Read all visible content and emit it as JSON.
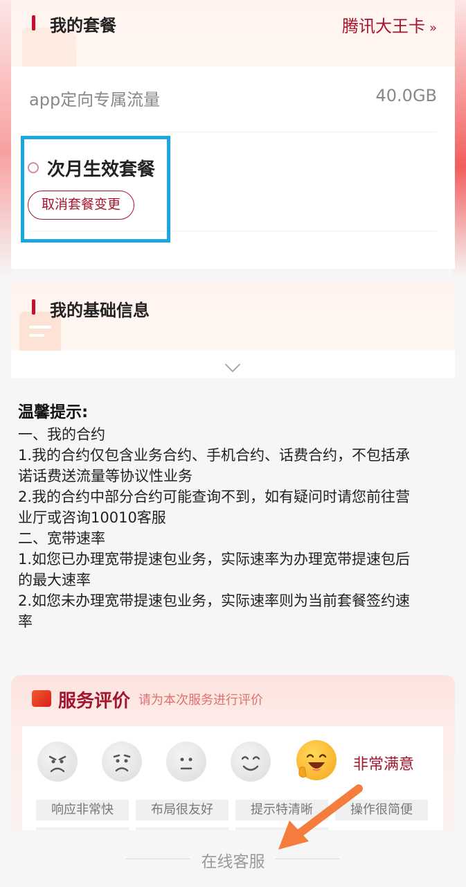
{
  "package": {
    "title": "我的套餐",
    "link_label": "腾讯大王卡",
    "link_arrows": "»",
    "rows": [
      {
        "label": "app定向专属流量",
        "value": "40.0GB"
      }
    ],
    "next_month": {
      "title": "次月生效套餐",
      "cancel_label": "取消套餐变更"
    }
  },
  "basic_info": {
    "title": "我的基础信息"
  },
  "tips": {
    "title": "温馨提示:",
    "lines": [
      "一、我的合约",
      "1.我的合约仅包含业务合约、手机合约、话费合约，不包括承",
      "诺话费送流量等协议性业务",
      "2.我的合约中部分合约可能查询不到，如有疑问时请您前往营",
      "业厅或咨询10010客服",
      "二、宽带速率",
      "1.如您已办理宽带提速包业务，实际速率为办理宽带提速包后",
      "的最大速率",
      "2.如您未办理宽带提速包业务，实际速率则为当前套餐签约速",
      "率"
    ]
  },
  "rating": {
    "title": "服务评价",
    "subtitle": "请为本次服务进行评价",
    "selected_label": "非常满意",
    "tags": [
      "响应非常快",
      "布局很友好",
      "提示特清晰",
      "操作很简便"
    ],
    "faces": [
      "very-unsatisfied-face-icon",
      "unsatisfied-face-icon",
      "neutral-face-icon",
      "satisfied-face-icon",
      "very-satisfied-face-icon"
    ]
  },
  "footer": {
    "label": "在线客服"
  },
  "colors": {
    "brand": "#a3152d",
    "highlight": "#1aa7e0",
    "annotation_arrow": "#f47c3c"
  }
}
